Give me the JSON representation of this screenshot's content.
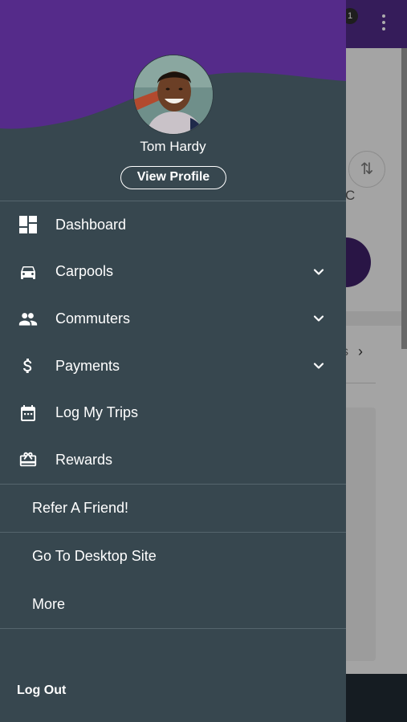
{
  "background": {
    "notification_count": "1",
    "partial_letter": "C",
    "partial_link_text": "s",
    "colors": {
      "topbar": "#4f2a85",
      "accent_circle": "#3d1f66"
    }
  },
  "drawer": {
    "colors": {
      "header_purple": "#552b8a",
      "body": "#37474f",
      "divider": "#55656d"
    },
    "profile": {
      "name": "Tom Hardy",
      "view_profile_label": "View Profile",
      "avatar": "avatar-photo"
    },
    "nav_items": [
      {
        "label": "Dashboard",
        "icon": "dashboard-icon",
        "expandable": false
      },
      {
        "label": "Carpools",
        "icon": "car-icon",
        "expandable": true
      },
      {
        "label": "Commuters",
        "icon": "people-icon",
        "expandable": true
      },
      {
        "label": "Payments",
        "icon": "dollar-icon",
        "expandable": true
      },
      {
        "label": "Log My Trips",
        "icon": "calendar-icon",
        "expandable": false
      },
      {
        "label": "Rewards",
        "icon": "gift-card-icon",
        "expandable": false
      }
    ],
    "secondary_items": [
      {
        "label": "Refer A Friend!"
      },
      {
        "label": "Go To Desktop Site"
      },
      {
        "label": "More"
      }
    ],
    "logout_label": "Log Out"
  }
}
